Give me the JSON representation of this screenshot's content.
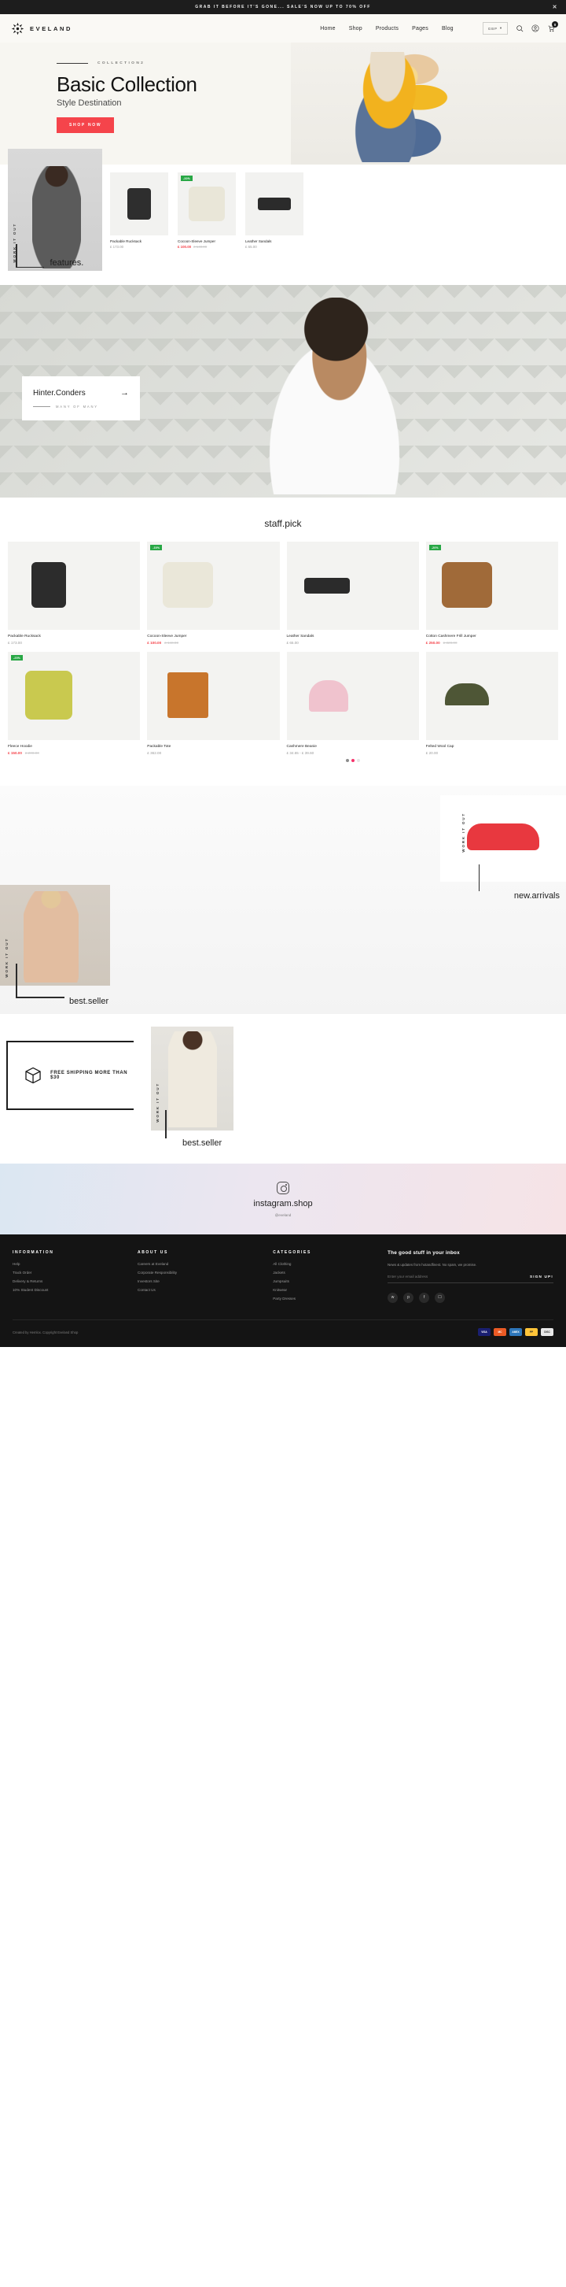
{
  "announcement": {
    "text": "GRAB IT BEFORE IT'S GONE... SALE'S NOW UP TO 70% OFF",
    "close": "✕"
  },
  "header": {
    "brand": "EVELAND",
    "nav": [
      "Home",
      "Shop",
      "Products",
      "Pages",
      "Blog"
    ],
    "currency": "GBP",
    "cart_count": "0"
  },
  "hero": {
    "eyebrow": "COLLECTION2",
    "title": "Basic Collection",
    "subtitle": "Style Destination",
    "cta": "SHOP NOW"
  },
  "features": {
    "vertical_tag": "WORK IT OUT",
    "label": "features.",
    "products": [
      {
        "name": "Packable Rucksack",
        "price": "£ 173.00",
        "sale": false,
        "old": "",
        "chip": ""
      },
      {
        "name": "Cocoon-Sleeve Jumper",
        "price": "£ 100.00",
        "sale": true,
        "old": "£ 140.00",
        "chip": "-30%"
      },
      {
        "name": "Leather Sandals",
        "price": "£ 65.00",
        "sale": false,
        "old": "",
        "chip": ""
      }
    ]
  },
  "banner": {
    "title": "Hinter.Conders",
    "subtitle": "MANY OF MANY",
    "arrow": "→"
  },
  "staff_pick": {
    "title": "staff.pick",
    "products": [
      {
        "name": "Packable Rucksack",
        "price": "£ 173.00",
        "sale": false,
        "old": "",
        "chip": ""
      },
      {
        "name": "Cocoon-Sleeve Jumper",
        "price": "£ 100.00",
        "sale": true,
        "old": "£ 140.00",
        "chip": "-30%"
      },
      {
        "name": "Leather Sandals",
        "price": "£ 65.00",
        "sale": false,
        "old": "",
        "chip": ""
      },
      {
        "name": "Cotton Cashmere Frill Jumper",
        "price": "£ 250.00",
        "sale": true,
        "old": "£ 320.00",
        "chip": "-20%"
      },
      {
        "name": "Fleece Hoodie",
        "price": "£ 150.00",
        "sale": true,
        "old": "£ 200.00",
        "chip": "-25%"
      },
      {
        "name": "Packable Tote",
        "price": "£ 362.00",
        "sale": false,
        "old": "",
        "chip": ""
      },
      {
        "name": "Cashmere Beanie",
        "price": "£ 34.65 - £ 39.60",
        "sale": false,
        "old": "",
        "chip": ""
      },
      {
        "name": "Felted Wool Cap",
        "price": "£ 20.00",
        "sale": false,
        "old": "",
        "chip": ""
      }
    ],
    "beanie_swatches": [
      "#8c8c8c",
      "#f5326a",
      "#e6e6e6"
    ]
  },
  "showcase": {
    "arrivals_tag": "WORK IT OUT",
    "arrivals_label": "new.arrivals",
    "seller_tag": "WORK IT OUT",
    "seller_label": "best.seller"
  },
  "shipping": {
    "text": "FREE SHIPPING MORE THAN $30",
    "icon": "box-icon"
  },
  "seller2": {
    "tag": "WORK IT OUT",
    "label": "best.seller"
  },
  "instagram": {
    "title": "instagram.shop",
    "handle": "@eveland",
    "icon": "instagram-icon"
  },
  "footer": {
    "columns": [
      {
        "heading": "INFORMATION",
        "links": [
          "Help",
          "Track Order",
          "Delivery & Returns",
          "10% Student Discount"
        ]
      },
      {
        "heading": "ABOUT US",
        "links": [
          "Careers at Eveland",
          "Corporate Responsibility",
          "Investors Site",
          "Contact Us"
        ]
      },
      {
        "heading": "CATEGORIES",
        "links": [
          "All Clothing",
          "Jackets",
          "Jumpsuits",
          "Knitwear",
          "Party Dresses"
        ]
      }
    ],
    "newsletter": {
      "heading": "The good stuff in your inbox",
      "desc": "News & updates from hotandfinest. No spam, we promise.",
      "placeholder": "Enter your email address",
      "button": "SIGN UP!"
    },
    "socials": [
      "twitter-icon",
      "pinterest-icon",
      "facebook-icon",
      "instagram-icon"
    ],
    "copyright": "Created by Hemlox. Copyright Eveland Shop",
    "payments": [
      "VISA",
      "MC",
      "AMEX",
      "PP",
      "DISC"
    ]
  }
}
